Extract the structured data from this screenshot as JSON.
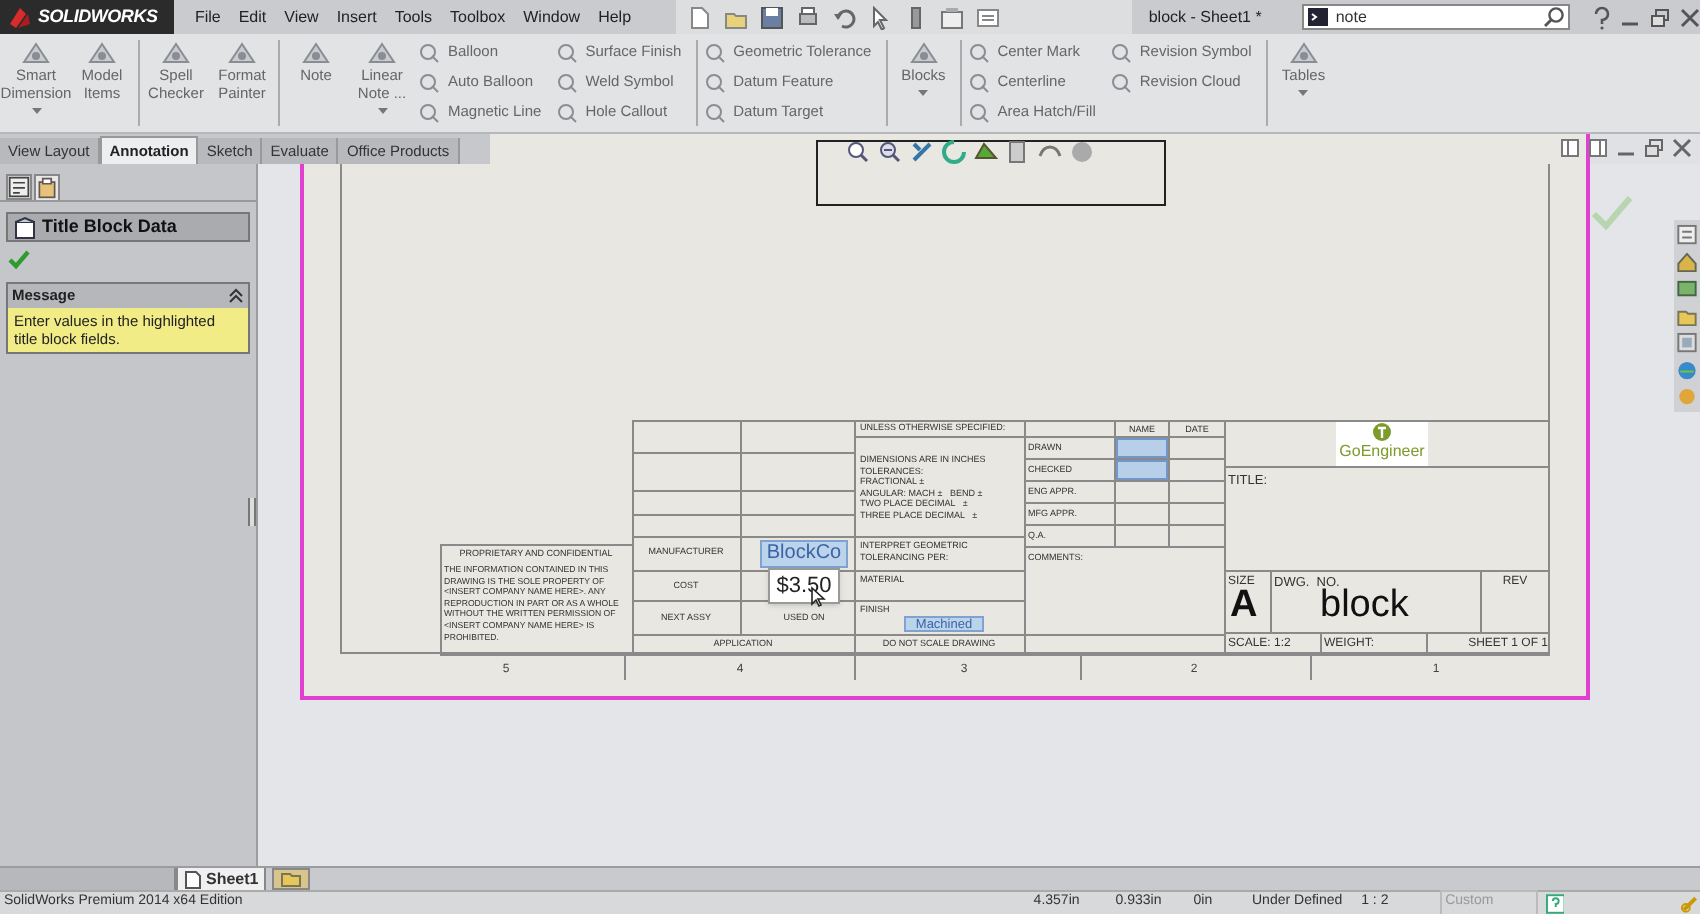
{
  "app": {
    "logo": "SOLIDWORKS",
    "menu": [
      "File",
      "Edit",
      "View",
      "Insert",
      "Tools",
      "Toolbox",
      "Window",
      "Help"
    ],
    "document_title": "block - Sheet1 *",
    "search": {
      "value": "note"
    }
  },
  "ribbon": {
    "groups": [
      [
        {
          "kind": "large",
          "label": "Smart Dimension",
          "dropdown": true
        },
        {
          "kind": "large",
          "label": "Model Items",
          "dropdown": false
        }
      ],
      [
        {
          "kind": "large",
          "label": "Spell Checker",
          "dropdown": false
        },
        {
          "kind": "large",
          "label": "Format Painter",
          "dropdown": false
        }
      ],
      [
        {
          "kind": "large",
          "label": "Note",
          "dropdown": false
        },
        {
          "kind": "large",
          "label": "Linear Note ...",
          "dropdown": true
        },
        {
          "kind": "stack",
          "items": [
            "Balloon",
            "Auto Balloon",
            "Magnetic Line"
          ]
        },
        {
          "kind": "stack",
          "items": [
            "Surface Finish",
            "Weld Symbol",
            "Hole Callout"
          ]
        }
      ],
      [
        {
          "kind": "stack",
          "items": [
            "Geometric Tolerance",
            "Datum Feature",
            "Datum Target"
          ]
        }
      ],
      [
        {
          "kind": "large",
          "label": "Blocks",
          "dropdown": true
        }
      ],
      [
        {
          "kind": "stack",
          "items": [
            "Center Mark",
            "Centerline",
            "Area Hatch/Fill"
          ]
        },
        {
          "kind": "stack",
          "items": [
            "Revision Symbol",
            "Revision Cloud"
          ]
        }
      ],
      [
        {
          "kind": "large",
          "label": "Tables",
          "dropdown": true
        }
      ]
    ]
  },
  "tabs": [
    {
      "label": "View Layout",
      "selected": false
    },
    {
      "label": "Annotation",
      "selected": true
    },
    {
      "label": "Sketch",
      "selected": false
    },
    {
      "label": "Evaluate",
      "selected": false
    },
    {
      "label": "Office Products",
      "selected": false
    }
  ],
  "property_manager": {
    "title": "Title Block Data",
    "message": {
      "heading": "Message",
      "text": "Enter values in the highlighted title block fields."
    }
  },
  "title_block": {
    "proprietary": {
      "heading": "PROPRIETARY AND CONFIDENTIAL",
      "text": "THE INFORMATION CONTAINED IN THIS DRAWING IS THE SOLE PROPERTY OF <INSERT COMPANY NAME HERE>. ANY REPRODUCTION IN PART OR AS A WHOLE WITHOUT THE WRITTEN PERMISSION OF <INSERT COMPANY NAME HERE> IS PROHIBITED."
    },
    "manufacturer": {
      "label": "MANUFACTURER",
      "value": "BlockCo",
      "highlighted": true
    },
    "cost": {
      "label": "COST",
      "value": "$3.50"
    },
    "next_assy": "NEXT ASSY",
    "used_on": "USED ON",
    "application": "APPLICATION",
    "tolerances": {
      "heading": "UNLESS OTHERWISE SPECIFIED:",
      "lines": [
        "DIMENSIONS ARE IN INCHES",
        "TOLERANCES:",
        "FRACTIONAL ±",
        "ANGULAR: MACH ±   BEND ±",
        "TWO PLACE DECIMAL   ±",
        "THREE PLACE DECIMAL   ±"
      ]
    },
    "interpret": "INTERPRET GEOMETRIC TOLERANCING PER:",
    "material": "MATERIAL",
    "finish": {
      "label": "FINISH",
      "value": "Machined",
      "highlighted": true
    },
    "do_not_scale": "DO NOT SCALE DRAWING",
    "approvals": {
      "columns": [
        "NAME",
        "DATE"
      ],
      "rows": [
        {
          "label": "DRAWN",
          "highlighted": true
        },
        {
          "label": "CHECKED",
          "highlighted": true
        },
        {
          "label": "ENG APPR.",
          "highlighted": false
        },
        {
          "label": "MFG APPR.",
          "highlighted": false
        },
        {
          "label": "Q.A.",
          "highlighted": false
        }
      ]
    },
    "comments": "COMMENTS:",
    "logo": "GoEngineer",
    "title_label": "TITLE:",
    "size_label": "SIZE",
    "size": "A",
    "dwg_no_label": "DWG.  NO.",
    "dwg_no": "block",
    "rev_label": "REV",
    "scale": "SCALE: 1:2",
    "weight": "WEIGHT:",
    "sheet": "SHEET 1 OF 1"
  },
  "zones": [
    "5",
    "4",
    "3",
    "2",
    "1"
  ],
  "sheet_tabs": [
    {
      "label": "Sheet1",
      "selected": true
    }
  ],
  "status_bar": {
    "edition": "SolidWorks Premium 2014 x64 Edition",
    "x": "4.357in",
    "y": "0.933in",
    "z": "0in",
    "state": "Under Defined",
    "scale": "1 : 2",
    "units": "Custom"
  }
}
